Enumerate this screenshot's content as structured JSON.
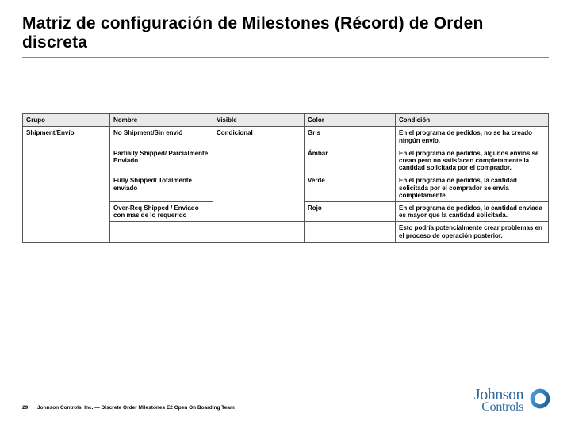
{
  "title": "Matriz de configuración de Milestones (Récord) de Orden discreta",
  "columns": {
    "grupo": "Grupo",
    "nombre": "Nombre",
    "visible": "Visible",
    "color": "Color",
    "condicion": "Condición"
  },
  "group_label": "Shipment/Envío",
  "rows": [
    {
      "nombre": "No Shipment/Sin envió",
      "visible": "Condicional",
      "color": "Gris",
      "condicion": "En el programa de pedidos, no se ha creado ningún envío."
    },
    {
      "nombre": "Partially Shipped/ Parcialmente Enviado",
      "visible": "",
      "color": "Ámbar",
      "condicion": "En el programa de pedidos, algunos envíos se crean pero no satisfacen completamente la cantidad solicitada por el comprador."
    },
    {
      "nombre": "Fully Shipped/ Totalmente enviado",
      "visible": "",
      "color": "Verde",
      "condicion": "En el programa de pedidos, la cantidad solicitada por el comprador se envía completamente."
    },
    {
      "nombre": "Over-Req Shipped / Enviado con mas de lo requerido",
      "visible": "",
      "color": "Rojo",
      "condicion": "En el programa de pedidos, la cantidad enviada es mayor que la cantidad solicitada."
    }
  ],
  "note": "Esto podría potencialmente crear problemas en el proceso de operación posterior.",
  "footer": {
    "page": "29",
    "text": "Johnson Controls, Inc. — Discrete Order Milestones E2 Open On Boarding Team"
  },
  "logo": {
    "line1": "Johnson",
    "line2": "Controls"
  }
}
